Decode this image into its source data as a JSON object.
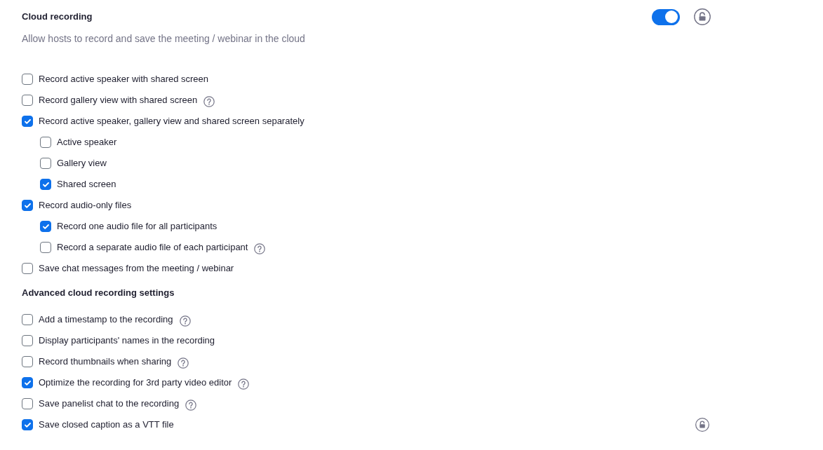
{
  "cloud_recording": {
    "title": "Cloud recording",
    "description": "Allow hosts to record and save the meeting / webinar in the cloud",
    "enabled": true
  },
  "options": [
    {
      "label": "Record active speaker with shared screen",
      "checked": false,
      "help": false
    },
    {
      "label": "Record gallery view with shared screen",
      "checked": false,
      "help": true
    },
    {
      "label": "Record active speaker, gallery view and shared screen separately",
      "checked": true,
      "help": false,
      "children": [
        {
          "label": "Active speaker",
          "checked": false,
          "help": false
        },
        {
          "label": "Gallery view",
          "checked": false,
          "help": false
        },
        {
          "label": "Shared screen",
          "checked": true,
          "help": false
        }
      ]
    },
    {
      "label": "Record audio-only files",
      "checked": true,
      "help": false,
      "children": [
        {
          "label": "Record one audio file for all participants",
          "checked": true,
          "help": false
        },
        {
          "label": "Record a separate audio file of each participant",
          "checked": false,
          "help": true
        }
      ]
    },
    {
      "label": "Save chat messages from the meeting / webinar",
      "checked": false,
      "help": false
    }
  ],
  "advanced": {
    "title": "Advanced cloud recording settings",
    "options": [
      {
        "label": "Add a timestamp to the recording",
        "checked": false,
        "help": true
      },
      {
        "label": "Display participants' names in the recording",
        "checked": false,
        "help": false
      },
      {
        "label": "Record thumbnails when sharing",
        "checked": false,
        "help": true
      },
      {
        "label": "Optimize the recording for 3rd party video editor",
        "checked": true,
        "help": true
      },
      {
        "label": "Save panelist chat to the recording",
        "checked": false,
        "help": true
      },
      {
        "label": "Save closed caption as a VTT file",
        "checked": true,
        "help": false,
        "lock": true
      }
    ]
  }
}
